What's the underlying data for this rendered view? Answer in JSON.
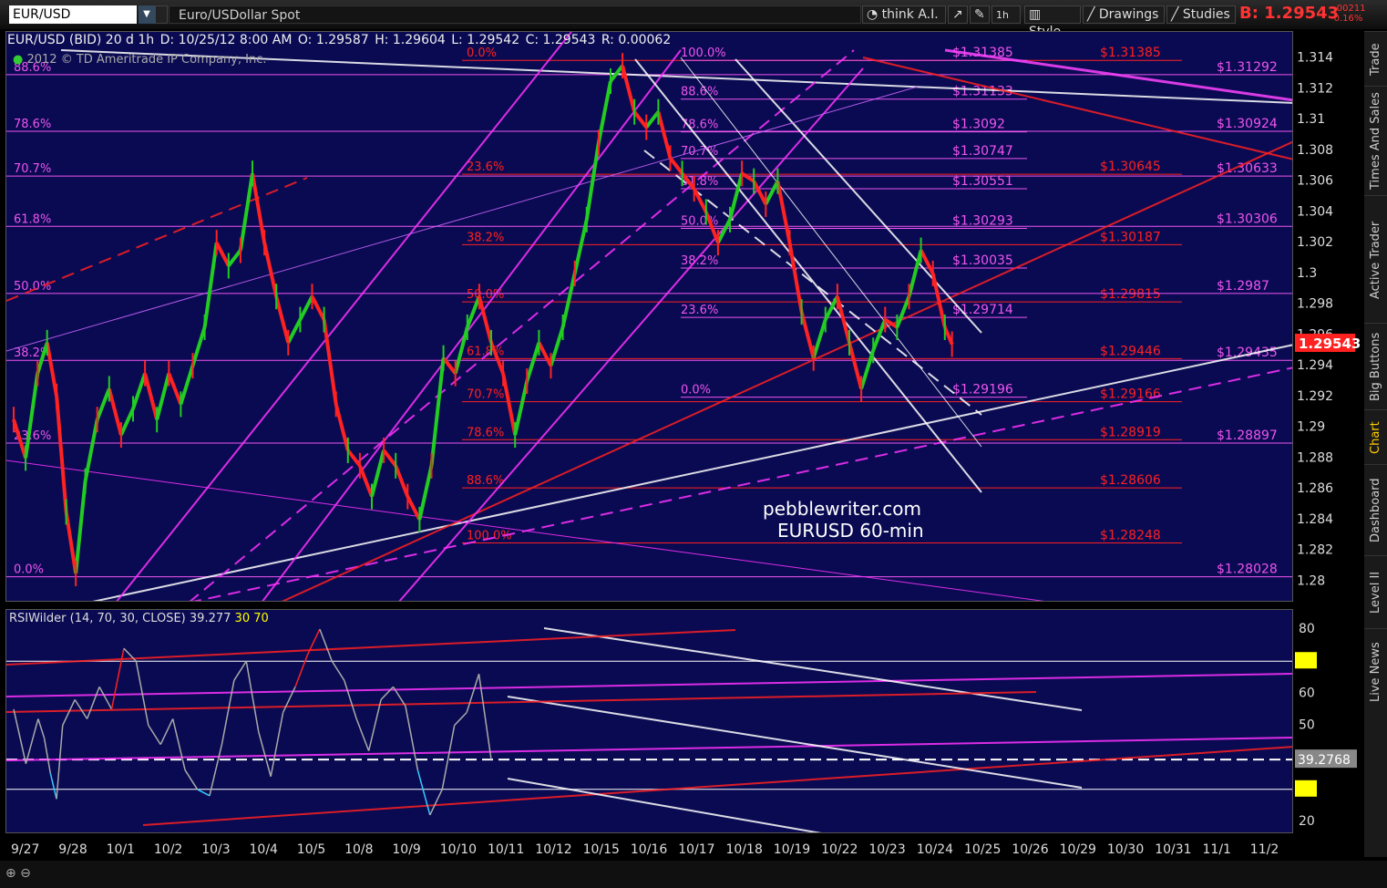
{
  "toolbar": {
    "symbol": "EUR/USD",
    "description": "Euro/USDollar Spot",
    "think_ai": "think A.I.",
    "period": "1h",
    "style": "Style",
    "drawings": "Drawings",
    "studies": "Studies",
    "last_label": "B: 1.29543",
    "change_abs": "-.00211",
    "change_pct": "-0.16%"
  },
  "header": {
    "instrument": "EUR/USD (BID) 20 d 1h",
    "date": "D: 10/25/12 8:00 AM",
    "open": "O: 1.29587",
    "high": "H: 1.29604",
    "low": "L: 1.29542",
    "close": "C: 1.29543",
    "range": "R: 0.00062",
    "copyright": "2012 © TD Ameritrade IP Company, Inc."
  },
  "sidebar": [
    "Trade",
    "Times And Sales",
    "Active Trader",
    "Big Buttons",
    "Chart",
    "Dashboard",
    "Level II",
    "Live News"
  ],
  "watermark": {
    "line1": "pebblewriter.com",
    "line2": "EURUSD 60-min"
  },
  "colors": {
    "background": "#0a0a52",
    "up": "#22cc22",
    "down": "#ff2222",
    "fib_red": "#ff2020",
    "fib_magenta": "#dd33dd",
    "channel": "#ffffff"
  },
  "rsi_header": {
    "study": "RSIWilder (14, 70, 30, CLOSE)",
    "value": "39.277",
    "ob": "30",
    "os": "70"
  },
  "chart_data": [
    {
      "type": "line",
      "title": "EUR/USD (BID) 20 d 1h",
      "x_ticks": [
        "9/27",
        "9/28",
        "10/1",
        "10/2",
        "10/3",
        "10/4",
        "10/5",
        "10/8",
        "10/9",
        "10/10",
        "10/11",
        "10/12",
        "10/15",
        "10/16",
        "10/17",
        "10/18",
        "10/19",
        "10/22",
        "10/23",
        "10/24",
        "10/25",
        "10/26",
        "10/29",
        "10/30",
        "10/31",
        "11/1",
        "11/2"
      ],
      "y_ticks": [
        1.28,
        1.282,
        1.284,
        1.286,
        1.288,
        1.29,
        1.292,
        1.294,
        1.296,
        1.298,
        1.3,
        1.302,
        1.304,
        1.306,
        1.308,
        1.31,
        1.312,
        1.314
      ],
      "ylim": [
        1.2786,
        1.3157
      ],
      "series": [
        {
          "name": "EUR/USD",
          "values": [
            [
              0,
              1.2905
            ],
            [
              0.5,
              1.288
            ],
            [
              1,
              1.2935
            ],
            [
              1.4,
              1.2955
            ],
            [
              1.8,
              1.292
            ],
            [
              2.2,
              1.2845
            ],
            [
              2.6,
              1.2805
            ],
            [
              3,
              1.2865
            ],
            [
              3.5,
              1.2905
            ],
            [
              4,
              1.2925
            ],
            [
              4.5,
              1.2895
            ],
            [
              5,
              1.2912
            ],
            [
              5.5,
              1.2935
            ],
            [
              6,
              1.2905
            ],
            [
              6.5,
              1.2935
            ],
            [
              7,
              1.2915
            ],
            [
              7.5,
              1.294
            ],
            [
              8,
              1.2965
            ],
            [
              8.5,
              1.302
            ],
            [
              9,
              1.3005
            ],
            [
              9.5,
              1.3015
            ],
            [
              10,
              1.3065
            ],
            [
              10.5,
              1.302
            ],
            [
              11,
              1.2985
            ],
            [
              11.5,
              1.2955
            ],
            [
              12,
              1.297
            ],
            [
              12.5,
              1.2985
            ],
            [
              13,
              1.297
            ],
            [
              13.5,
              1.2915
            ],
            [
              14,
              1.2885
            ],
            [
              14.5,
              1.2875
            ],
            [
              15,
              1.2855
            ],
            [
              15.5,
              1.2885
            ],
            [
              16,
              1.2875
            ],
            [
              16.5,
              1.2855
            ],
            [
              17,
              1.284
            ],
            [
              17.5,
              1.2875
            ],
            [
              18,
              1.2945
            ],
            [
              18.5,
              1.2935
            ],
            [
              19,
              1.2965
            ],
            [
              19.5,
              1.2985
            ],
            [
              20,
              1.2955
            ],
            [
              20.5,
              1.2935
            ],
            [
              21,
              1.2895
            ],
            [
              21.5,
              1.293
            ],
            [
              22,
              1.2955
            ],
            [
              22.5,
              1.294
            ],
            [
              23,
              1.2965
            ],
            [
              23.5,
              1.3
            ],
            [
              24,
              1.3035
            ],
            [
              24.5,
              1.3085
            ],
            [
              25,
              1.3125
            ],
            [
              25.5,
              1.3135
            ],
            [
              26,
              1.3105
            ],
            [
              26.5,
              1.3095
            ],
            [
              27,
              1.3105
            ],
            [
              27.5,
              1.3075
            ],
            [
              28,
              1.3065
            ],
            [
              28.5,
              1.3055
            ],
            [
              29,
              1.304
            ],
            [
              29.5,
              1.302
            ],
            [
              30,
              1.3035
            ],
            [
              30.5,
              1.3065
            ],
            [
              31,
              1.306
            ],
            [
              31.5,
              1.3045
            ],
            [
              32,
              1.306
            ],
            [
              32.5,
              1.302
            ],
            [
              33,
              1.2975
            ],
            [
              33.5,
              1.2945
            ],
            [
              34,
              1.297
            ],
            [
              34.5,
              1.2985
            ],
            [
              35,
              1.2955
            ],
            [
              35.5,
              1.2925
            ],
            [
              36,
              1.295
            ],
            [
              36.5,
              1.297
            ],
            [
              37,
              1.2965
            ],
            [
              37.5,
              1.2985
            ],
            [
              38,
              1.3015
            ],
            [
              38.5,
              1.3
            ],
            [
              39,
              1.2965
            ],
            [
              39.3,
              1.2954
            ]
          ]
        }
      ],
      "fib_levels_red": [
        {
          "pct": "0.0%",
          "price": "$1.31385"
        },
        {
          "pct": "23.6%",
          "price": "$1.30645"
        },
        {
          "pct": "38.2%",
          "price": "$1.30187"
        },
        {
          "pct": "50.0%",
          "price": "$1.29815"
        },
        {
          "pct": "61.8%",
          "price": "$1.29446"
        },
        {
          "pct": "70.7%",
          "price": "$1.29166"
        },
        {
          "pct": "78.6%",
          "price": "$1.28919"
        },
        {
          "pct": "88.6%",
          "price": "$1.28606"
        },
        {
          "pct": "100.0%",
          "price": "$1.28248"
        }
      ],
      "fib_levels_magenta_a": [
        {
          "pct": "100.0%",
          "price": "$1.31385"
        },
        {
          "pct": "88.6%",
          "price": "$1.31133"
        },
        {
          "pct": "78.6%",
          "price": "$1.3092"
        },
        {
          "pct": "70.7%",
          "price": "$1.30747"
        },
        {
          "pct": "61.8%",
          "price": "$1.30551"
        },
        {
          "pct": "50.0%",
          "price": "$1.30293"
        },
        {
          "pct": "38.2%",
          "price": "$1.30035"
        },
        {
          "pct": "23.6%",
          "price": "$1.29714"
        },
        {
          "pct": "0.0%",
          "price": "$1.29196"
        }
      ],
      "fib_levels_magenta_b": [
        {
          "pct": "88.6%",
          "price": "$1.31292"
        },
        {
          "pct": "78.6%",
          "price": "$1.30924"
        },
        {
          "pct": "70.7%",
          "price": "$1.30633"
        },
        {
          "pct": "61.8%",
          "price": "$1.30306"
        },
        {
          "pct": "50.0%",
          "price": "$1.2987"
        },
        {
          "pct": "38.2%",
          "price": "$1.29435"
        },
        {
          "pct": "23.6%",
          "price": "$1.28897"
        },
        {
          "pct": "0.0%",
          "price": "$1.28028"
        }
      ],
      "last_price": "1.29543"
    },
    {
      "type": "line",
      "title": "RSIWilder (14, 70, 30, CLOSE)",
      "y_ticks": [
        20,
        30,
        40,
        50,
        60,
        70,
        80
      ],
      "ylim": [
        16,
        86
      ],
      "current_value": "39.2768",
      "overbought": "70",
      "oversold": "30",
      "series": [
        {
          "name": "RSIWilder",
          "values": [
            [
              0,
              55
            ],
            [
              1,
              38
            ],
            [
              2,
              52
            ],
            [
              2.5,
              46
            ],
            [
              3,
              35
            ],
            [
              3.5,
              27
            ],
            [
              4,
              50
            ],
            [
              5,
              58
            ],
            [
              6,
              52
            ],
            [
              7,
              62
            ],
            [
              8,
              55
            ],
            [
              9,
              74
            ],
            [
              10,
              70
            ],
            [
              11,
              50
            ],
            [
              12,
              44
            ],
            [
              13,
              52
            ],
            [
              14,
              36
            ],
            [
              15,
              30
            ],
            [
              16,
              28
            ],
            [
              17,
              44
            ],
            [
              18,
              64
            ],
            [
              19,
              70
            ],
            [
              20,
              48
            ],
            [
              21,
              34
            ],
            [
              22,
              54
            ],
            [
              23,
              62
            ],
            [
              24,
              72
            ],
            [
              25,
              80
            ],
            [
              26,
              70
            ],
            [
              27,
              64
            ],
            [
              28,
              52
            ],
            [
              29,
              42
            ],
            [
              30,
              58
            ],
            [
              31,
              62
            ],
            [
              32,
              56
            ],
            [
              33,
              36
            ],
            [
              34,
              22
            ],
            [
              35,
              30
            ],
            [
              36,
              50
            ],
            [
              37,
              54
            ],
            [
              38,
              66
            ],
            [
              39,
              39.3
            ]
          ]
        }
      ]
    }
  ]
}
